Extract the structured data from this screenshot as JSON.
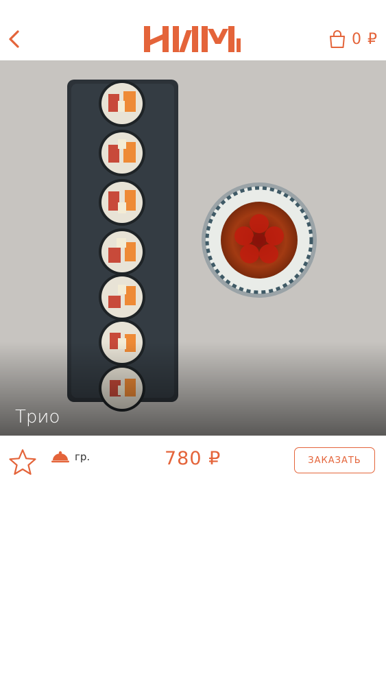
{
  "header": {
    "brand": "НИМИ",
    "cart_total": "0 ₽"
  },
  "product": {
    "name": "Трио",
    "weight_unit": "гр.",
    "price": "780 ₽",
    "order_label": "ЗАКАЗАТЬ"
  },
  "colors": {
    "accent": "#e4643a",
    "background": "#ffffff"
  },
  "icons": {
    "back": "chevron-left",
    "cart": "shopping-bag",
    "favorite": "star-outline",
    "weight": "cloche"
  }
}
